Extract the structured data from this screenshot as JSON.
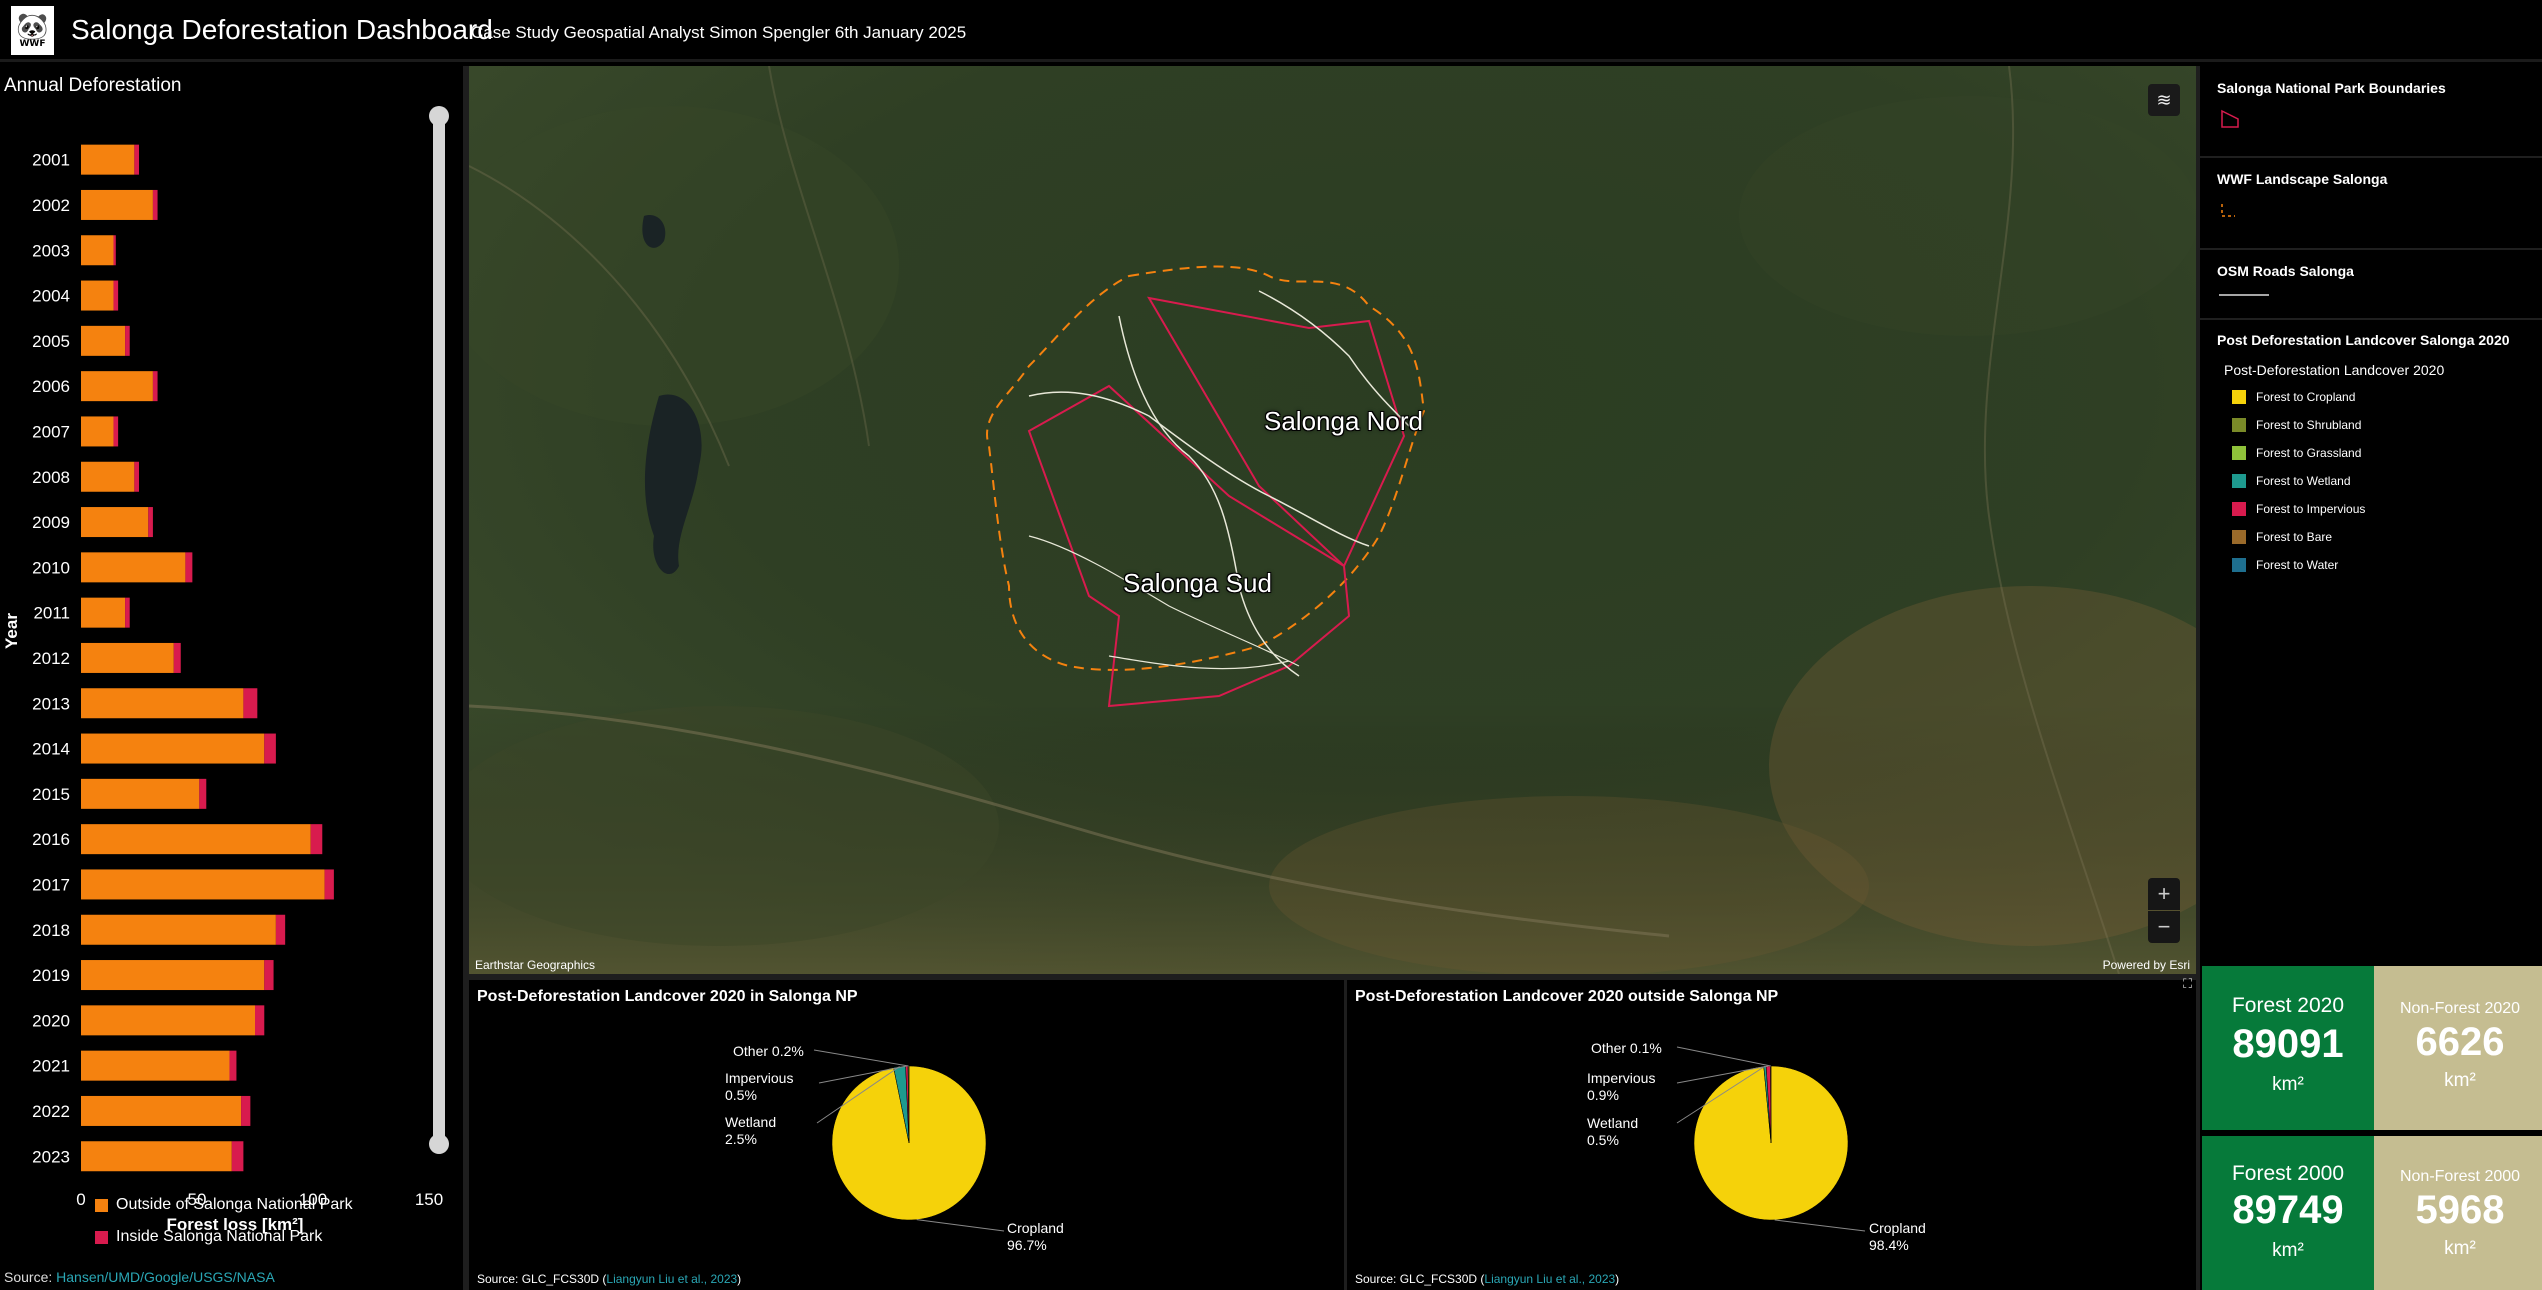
{
  "header": {
    "logo_text": "WWF",
    "title": "Salonga Deforestation Dashboard",
    "subtitle": "Case Study Geospatial Analyst Simon Spengler 6th January 2025"
  },
  "left_panel": {
    "title": "Annual Deforestation",
    "source_prefix": "Source: ",
    "source_link": "Hansen/UMD/Google/USGS/NASA"
  },
  "chart_data": {
    "type": "bar",
    "orientation": "horizontal",
    "stacked": true,
    "title": "Annual Deforestation",
    "xlabel": "Forest loss [km²]",
    "ylabel": "Year",
    "xlim": [
      0,
      150
    ],
    "xticks": [
      0,
      50,
      100,
      150
    ],
    "categories": [
      "2001",
      "2002",
      "2003",
      "2004",
      "2005",
      "2006",
      "2007",
      "2008",
      "2009",
      "2010",
      "2011",
      "2012",
      "2013",
      "2014",
      "2015",
      "2016",
      "2017",
      "2018",
      "2019",
      "2020",
      "2021",
      "2022",
      "2023"
    ],
    "series": [
      {
        "name": "Outside of Salonga National Park",
        "color": "#f5820f",
        "values": [
          23,
          31,
          14,
          14,
          19,
          31,
          14,
          23,
          29,
          45,
          19,
          40,
          70,
          79,
          51,
          99,
          105,
          84,
          79,
          75,
          64,
          69,
          65
        ]
      },
      {
        "name": "Inside Salonga National Park",
        "color": "#d81b4e",
        "values": [
          2,
          2,
          1,
          2,
          2,
          2,
          2,
          2,
          2,
          3,
          2,
          3,
          6,
          5,
          3,
          5,
          4,
          4,
          4,
          4,
          3,
          4,
          5
        ]
      }
    ],
    "legend_position": "bottom",
    "grid": false
  },
  "map": {
    "label_north": "Salonga Nord",
    "label_south": "Salonga Sud",
    "attribution_left": "Earthstar Geographics",
    "attribution_right": "Powered by Esri",
    "layers_icon": "layers-icon",
    "zoom_in": "+",
    "zoom_out": "−"
  },
  "legend_panel": {
    "sections": [
      {
        "title": "Salonga National Park Boundaries",
        "symbol_color": "#d81b4e"
      },
      {
        "title": "WWF Landscape Salonga",
        "symbol_color": "#f5820f"
      },
      {
        "title": "OSM Roads Salonga",
        "symbol_color": "#dddddd"
      },
      {
        "title": "Post Deforestation Landcover Salonga 2020"
      }
    ],
    "landcover_subtitle": "Post-Deforestation Landcover 2020",
    "landcover_items": [
      {
        "label": "Forest to Cropland",
        "color": "#f5d20a"
      },
      {
        "label": "Forest to Shrubland",
        "color": "#7a8a28"
      },
      {
        "label": "Forest to Grassland",
        "color": "#8fc23a"
      },
      {
        "label": "Forest to Wetland",
        "color": "#1e9a8f"
      },
      {
        "label": "Forest to Impervious",
        "color": "#d81b4e"
      },
      {
        "label": "Forest to Bare",
        "color": "#9a6a2a"
      },
      {
        "label": "Forest to Water",
        "color": "#1e6f8f"
      }
    ]
  },
  "pie_inside": {
    "title": "Post-Deforestation Landcover 2020 in Salonga NP",
    "labels": [
      {
        "name": "Other",
        "value": "0.2%"
      },
      {
        "name": "Impervious",
        "value": "0.5%"
      },
      {
        "name": "Wetland",
        "value": "2.5%"
      },
      {
        "name": "Cropland",
        "value": "96.7%"
      }
    ],
    "slices": [
      96.7,
      2.5,
      0.5,
      0.2
    ],
    "source_prefix": "Source: GLC_FCS30D  (",
    "source_link": "Liangyun Liu et al., 2023",
    "source_suffix": ")"
  },
  "pie_outside": {
    "title": "Post-Deforestation Landcover 2020 outside Salonga NP",
    "labels": [
      {
        "name": "Other",
        "value": "0.1%"
      },
      {
        "name": "Impervious",
        "value": "0.9%"
      },
      {
        "name": "Wetland",
        "value": "0.5%"
      },
      {
        "name": "Cropland",
        "value": "98.4%"
      }
    ],
    "slices": [
      98.4,
      0.5,
      0.9,
      0.1
    ],
    "source_prefix": "Source: GLC_FCS30D  (",
    "source_link": "Liangyun Liu et al., 2023",
    "source_suffix": ")"
  },
  "pie_colors": [
    "#f5d20a",
    "#1e9a8f",
    "#d81b4e",
    "#7a8a28"
  ],
  "stats": {
    "forest_2020": {
      "label": "Forest 2020",
      "value": "89091",
      "unit": "km²"
    },
    "nonforest_2020": {
      "label": "Non-Forest 2020",
      "value": "6626",
      "unit": "km²"
    },
    "forest_2000": {
      "label": "Forest 2000",
      "value": "89749",
      "unit": "km²"
    },
    "nonforest_2000": {
      "label": "Non-Forest 2000",
      "value": "5968",
      "unit": "km²"
    }
  }
}
